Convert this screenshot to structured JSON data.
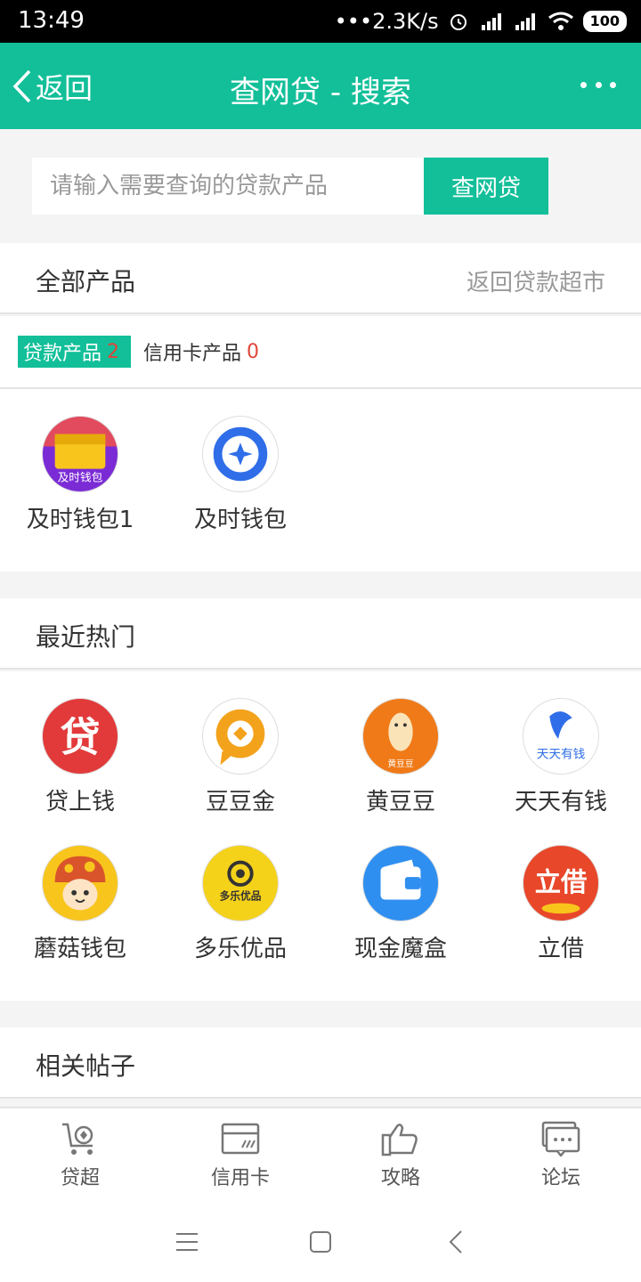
{
  "status": {
    "time": "13:49",
    "speed": "•••2.3K/s",
    "battery": "100"
  },
  "header": {
    "back_label": "返回",
    "title": "查网贷 - 搜索"
  },
  "search": {
    "placeholder": "请输入需要查询的贷款产品",
    "button_label": "查网贷"
  },
  "all_products": {
    "title": "全部产品",
    "link": "返回贷款超市",
    "tabs": [
      {
        "label": "贷款产品",
        "count": "2"
      },
      {
        "label": "信用卡产品",
        "count": "0"
      }
    ],
    "items": [
      {
        "name": "及时钱包1",
        "icon": "jishi-wallet-icon"
      },
      {
        "name": "及时钱包",
        "icon": "blue-star-icon"
      }
    ]
  },
  "hot": {
    "title": "最近热门",
    "items": [
      {
        "name": "贷上钱",
        "icon": "dai-icon"
      },
      {
        "name": "豆豆金",
        "icon": "doudoujin-icon"
      },
      {
        "name": "黄豆豆",
        "icon": "huangdoudou-icon"
      },
      {
        "name": "天天有钱",
        "icon": "tiantian-icon"
      },
      {
        "name": "蘑菇钱包",
        "icon": "mushroom-icon"
      },
      {
        "name": "多乐优品",
        "icon": "duole-icon"
      },
      {
        "name": "现金魔盒",
        "icon": "wallet-box-icon"
      },
      {
        "name": "立借",
        "icon": "lijie-icon"
      }
    ]
  },
  "posts": {
    "title": "相关帖子"
  },
  "icon_texts": {
    "jishi": "及时钱包",
    "huangdou": "黄豆豆",
    "tiantian": "天天有钱",
    "dai": "贷",
    "lijie": "立借",
    "duole": "多乐优品"
  },
  "bottom_nav": [
    {
      "label": "贷超",
      "icon": "cart-icon"
    },
    {
      "label": "信用卡",
      "icon": "card-icon"
    },
    {
      "label": "攻略",
      "icon": "thumbs-up-icon"
    },
    {
      "label": "论坛",
      "icon": "chat-icon"
    }
  ],
  "colors": {
    "brand": "#12bf99",
    "count": "#e0453a"
  }
}
